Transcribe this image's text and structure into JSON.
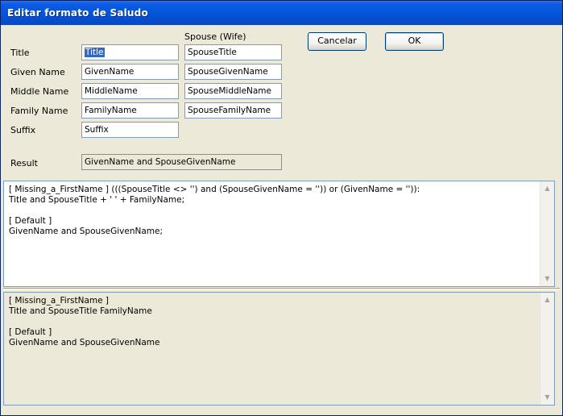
{
  "window": {
    "title": "Editar formato de Saludo"
  },
  "header": {
    "spouse_column": "Spouse (Wife)"
  },
  "buttons": {
    "cancel": "Cancelar",
    "ok": "OK"
  },
  "fields": {
    "title": {
      "label": "Title",
      "value": "Title",
      "spouse_value": "SpouseTitle"
    },
    "given": {
      "label": "Given Name",
      "value": "GivenName",
      "spouse_value": "SpouseGivenName"
    },
    "middle": {
      "label": "Middle Name",
      "value": "MiddleName",
      "spouse_value": "SpouseMiddleName"
    },
    "family": {
      "label": "Family Name",
      "value": "FamilyName",
      "spouse_value": "SpouseFamilyName"
    },
    "suffix": {
      "label": "Suffix",
      "value": "Suffix"
    },
    "result": {
      "label": "Result",
      "value": "GivenName and SpouseGivenName"
    }
  },
  "editor": {
    "lines": [
      "[ Missing_a_FirstName ] (((SpouseTitle <> '') and (SpouseGivenName = '')) or (GivenName = '')):",
      "Title and SpouseTitle + ' ' + FamilyName;",
      "",
      "[ Default ]",
      "GivenName and SpouseGivenName;"
    ]
  },
  "preview": {
    "lines": [
      "[ Missing_a_FirstName ]",
      "Title and SpouseTitle FamilyName",
      "",
      "[ Default ]",
      "GivenName and SpouseGivenName"
    ]
  }
}
